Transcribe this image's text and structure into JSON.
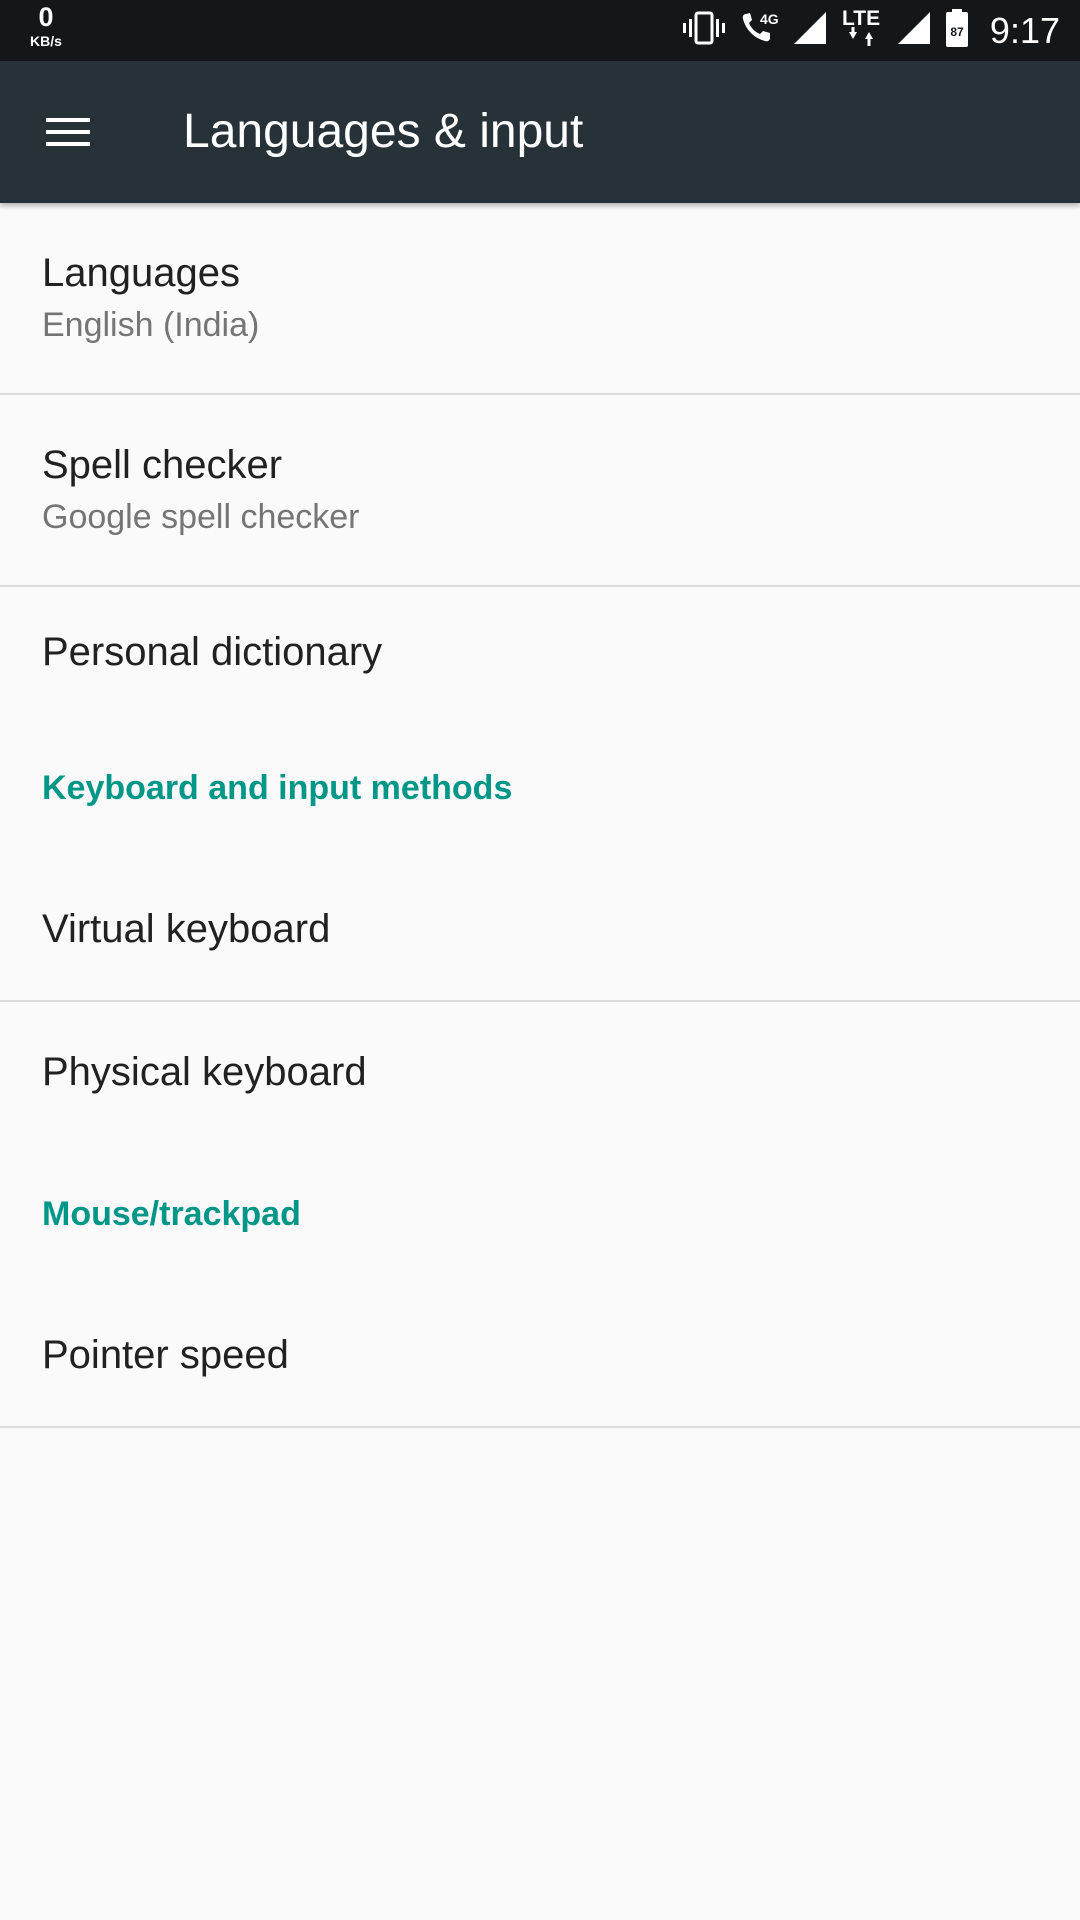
{
  "status_bar": {
    "net_speed_value": "0",
    "net_speed_unit": "KB/s",
    "lte_label": "LTE",
    "fourg_label": "4G",
    "battery_level": "87",
    "time": "9:17",
    "icons": [
      "vibrate-icon",
      "call-4g-icon",
      "signal-icon",
      "lte-data-icon",
      "signal-icon",
      "battery-icon"
    ]
  },
  "app_bar": {
    "menu_icon": "menu-icon",
    "title": "Languages & input",
    "background_color": "#263238"
  },
  "settings": {
    "languages": {
      "title": "Languages",
      "summary": "English (India)"
    },
    "spell_checker": {
      "title": "Spell checker",
      "summary": "Google spell checker"
    },
    "personal_dictionary": {
      "title": "Personal dictionary"
    },
    "keyboard_category": {
      "title": "Keyboard and input methods"
    },
    "virtual_keyboard": {
      "title": "Virtual keyboard"
    },
    "physical_keyboard": {
      "title": "Physical keyboard"
    },
    "mouse_category": {
      "title": "Mouse/trackpad"
    },
    "pointer_speed": {
      "title": "Pointer speed"
    }
  },
  "colors": {
    "accent": "#009688",
    "status_bar": "#13171a",
    "background": "#fafafa"
  }
}
